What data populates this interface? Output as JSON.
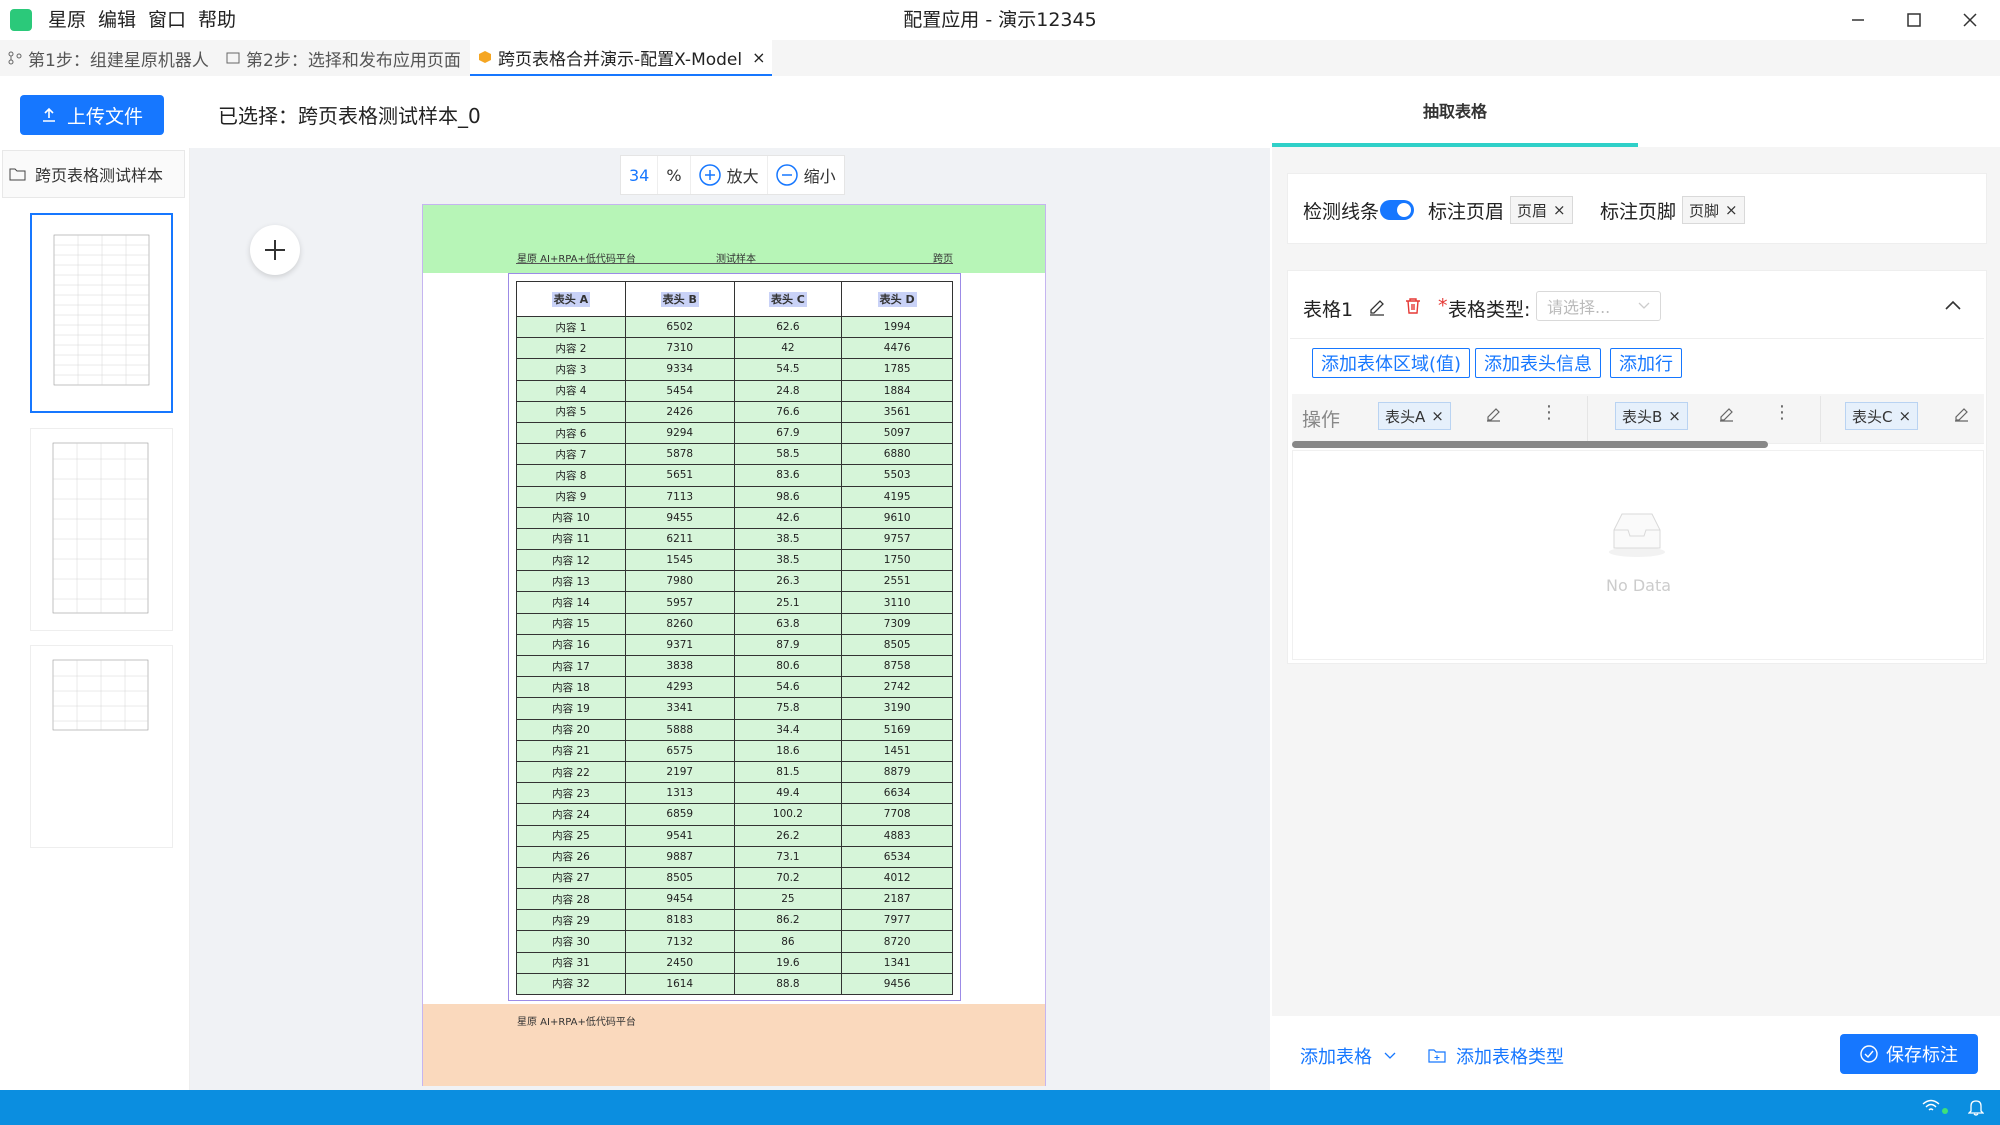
{
  "menu": {
    "items": [
      "星原",
      "编辑",
      "窗口",
      "帮助"
    ]
  },
  "window": {
    "title": "配置应用 - 演示12345"
  },
  "tabs": [
    {
      "label": "第1步：组建星原机器人"
    },
    {
      "label": "第2步：选择和发布应用页面"
    },
    {
      "label": "跨页表格合并演示-配置X-Model"
    }
  ],
  "toolbar": {
    "upload_label": "上传文件",
    "selected_label": "已选择：跨页表格测试样本_0"
  },
  "file_tree": {
    "folder_label": "跨页表格测试样本"
  },
  "zoom": {
    "value": "34",
    "unit": "%",
    "zoom_in": "放大",
    "zoom_out": "缩小"
  },
  "document": {
    "header_left": "星原 AI+RPA+低代码平台",
    "header_center": "测试样本",
    "header_right": "跨页",
    "footer_left": "星原 AI+RPA+低代码平台",
    "columns": [
      "表头 A",
      "表头 B",
      "表头 C",
      "表头 D"
    ],
    "rows": [
      [
        "内容 1",
        "6502",
        "62.6",
        "1994"
      ],
      [
        "内容 2",
        "7310",
        "42",
        "4476"
      ],
      [
        "内容 3",
        "9334",
        "54.5",
        "1785"
      ],
      [
        "内容 4",
        "5454",
        "24.8",
        "1884"
      ],
      [
        "内容 5",
        "2426",
        "76.6",
        "3561"
      ],
      [
        "内容 6",
        "9294",
        "67.9",
        "5097"
      ],
      [
        "内容 7",
        "5878",
        "58.5",
        "6880"
      ],
      [
        "内容 8",
        "5651",
        "83.6",
        "5503"
      ],
      [
        "内容 9",
        "7113",
        "98.6",
        "4195"
      ],
      [
        "内容 10",
        "9455",
        "42.6",
        "9610"
      ],
      [
        "内容 11",
        "6211",
        "38.5",
        "9757"
      ],
      [
        "内容 12",
        "1545",
        "38.5",
        "1750"
      ],
      [
        "内容 13",
        "7980",
        "26.3",
        "2551"
      ],
      [
        "内容 14",
        "5957",
        "25.1",
        "3110"
      ],
      [
        "内容 15",
        "8260",
        "63.8",
        "7309"
      ],
      [
        "内容 16",
        "9371",
        "87.9",
        "8505"
      ],
      [
        "内容 17",
        "3838",
        "80.6",
        "8758"
      ],
      [
        "内容 18",
        "4293",
        "54.6",
        "2742"
      ],
      [
        "内容 19",
        "3341",
        "75.8",
        "3190"
      ],
      [
        "内容 20",
        "5888",
        "34.4",
        "5169"
      ],
      [
        "内容 21",
        "6575",
        "18.6",
        "1451"
      ],
      [
        "内容 22",
        "2197",
        "81.5",
        "8879"
      ],
      [
        "内容 23",
        "1313",
        "49.4",
        "6634"
      ],
      [
        "内容 24",
        "6859",
        "100.2",
        "7708"
      ],
      [
        "内容 25",
        "9541",
        "26.2",
        "4883"
      ],
      [
        "内容 26",
        "9887",
        "73.1",
        "6534"
      ],
      [
        "内容 27",
        "8505",
        "70.2",
        "4012"
      ],
      [
        "内容 28",
        "9454",
        "25",
        "2187"
      ],
      [
        "内容 29",
        "8183",
        "86.2",
        "7977"
      ],
      [
        "内容 30",
        "7132",
        "86",
        "8720"
      ],
      [
        "内容 31",
        "2450",
        "19.6",
        "1341"
      ],
      [
        "内容 32",
        "1614",
        "88.8",
        "9456"
      ]
    ]
  },
  "panel": {
    "tab_label": "抽取表格",
    "detect_lines": "检测线条",
    "mark_header": "标注页眉",
    "header_chip": "页眉",
    "mark_footer": "标注页脚",
    "footer_chip": "页脚",
    "table_name": "表格1",
    "table_type_label": "表格类型:",
    "table_type_required": "*",
    "table_type_placeholder": "请选择...",
    "add_body": "添加表体区域(值)",
    "add_header_info": "添加表头信息",
    "add_row": "添加行",
    "op_label": "操作",
    "col_chips": [
      "表头A",
      "表头B",
      "表头C"
    ],
    "empty": "No Data",
    "add_table": "添加表格",
    "add_table_type": "添加表格类型",
    "save": "保存标注"
  },
  "colors": {
    "accent": "#1677ff",
    "header_band": "#b7f5b7",
    "footer_band": "#fad9bd",
    "status_bar": "#0b8ee0"
  }
}
